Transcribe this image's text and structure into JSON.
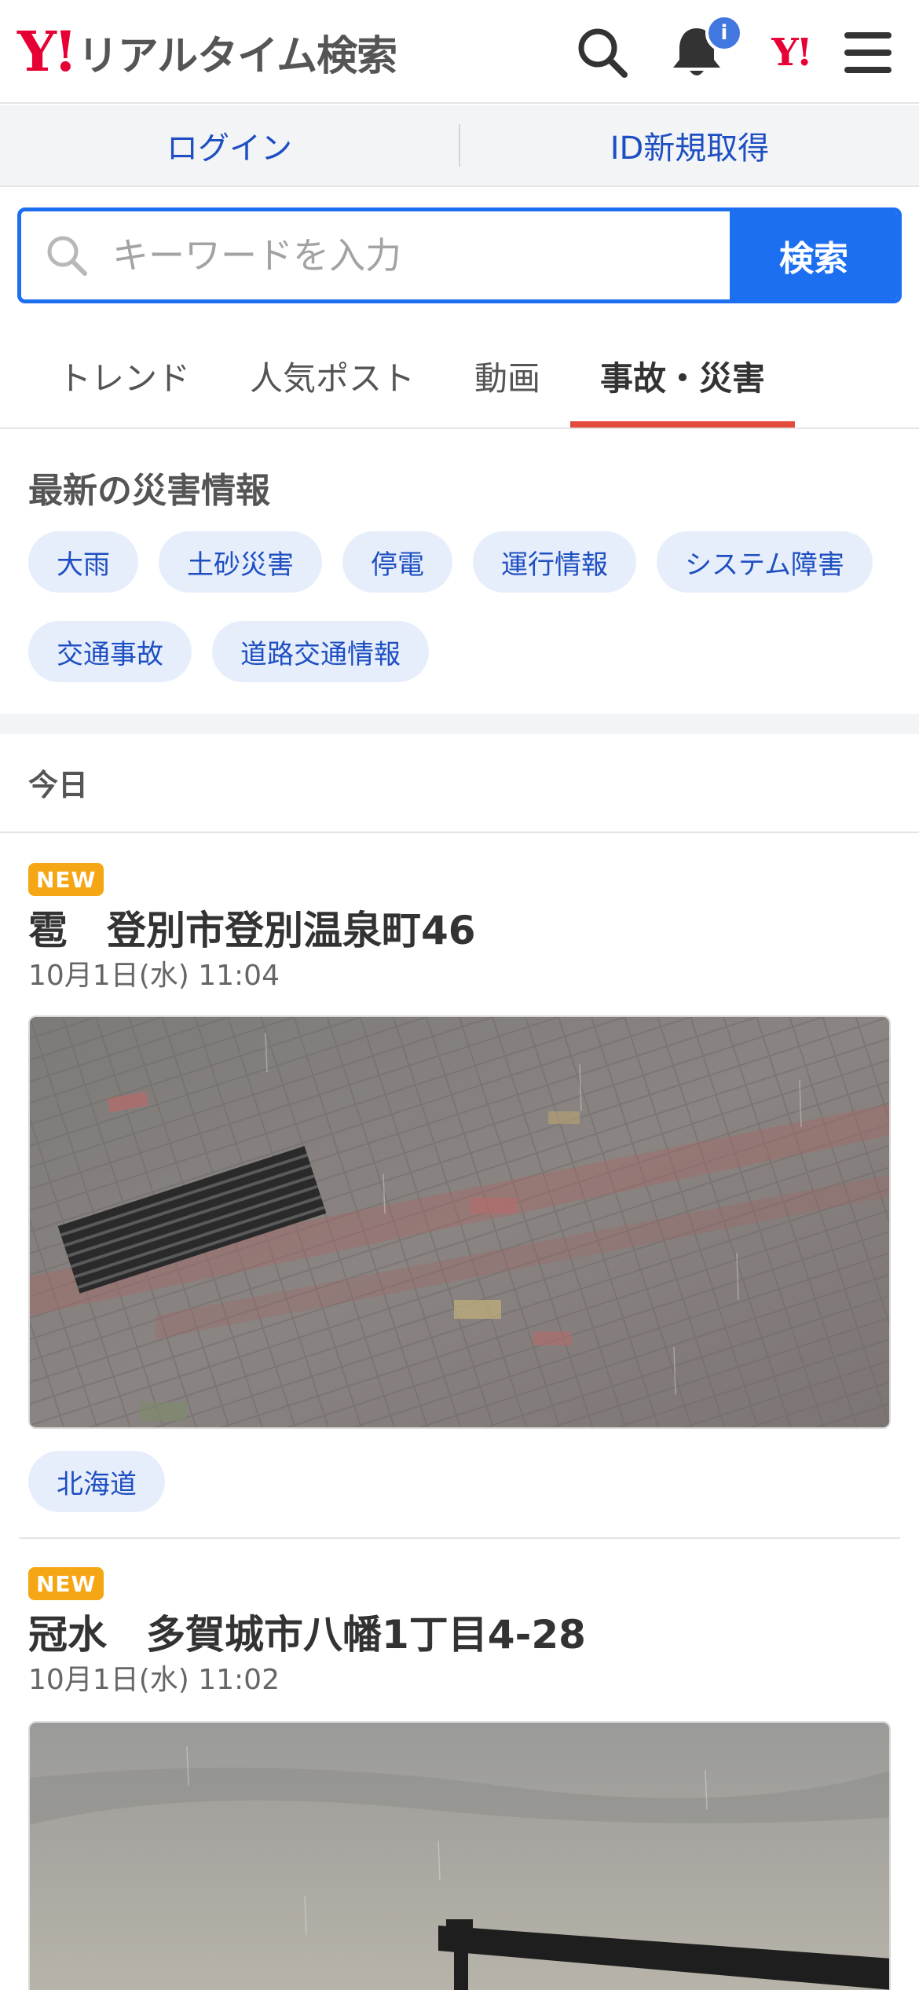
{
  "header": {
    "logo_mark": "Y!",
    "logo_text": "リアルタイム検索",
    "notification_badge": "i",
    "yahoo_mark": "Y!"
  },
  "login_bar": {
    "login": "ログイン",
    "register": "ID新規取得"
  },
  "search": {
    "placeholder": "キーワードを入力",
    "button": "検索"
  },
  "tabs": [
    {
      "label": "トレンド"
    },
    {
      "label": "人気ポスト"
    },
    {
      "label": "動画"
    },
    {
      "label": "事故・災害",
      "active": true
    }
  ],
  "disaster": {
    "title": "最新の災害情報",
    "chips": [
      "大雨",
      "土砂災害",
      "停電",
      "運行情報",
      "システム障害",
      "交通事故",
      "道路交通情報"
    ]
  },
  "day_label": "今日",
  "posts": [
    {
      "new_label": "NEW",
      "title": "雹　登別市登別温泉町46",
      "date": "10月1日(水) 11:04",
      "region": "北海道"
    },
    {
      "new_label": "NEW",
      "title": "冠水　多賀城市八幡1丁目4-28",
      "date": "10月1日(水) 11:02"
    }
  ],
  "colors": {
    "brand_red": "#e60033",
    "link_blue": "#1e4fc2",
    "search_blue": "#1d6ff2",
    "active_tab_underline": "#e34b3d",
    "new_badge": "#f5a614",
    "chip_bg": "#e7eefb"
  },
  "icons": {
    "search": "search-icon",
    "notification": "bell-icon",
    "menu": "hamburger-menu-icon"
  }
}
